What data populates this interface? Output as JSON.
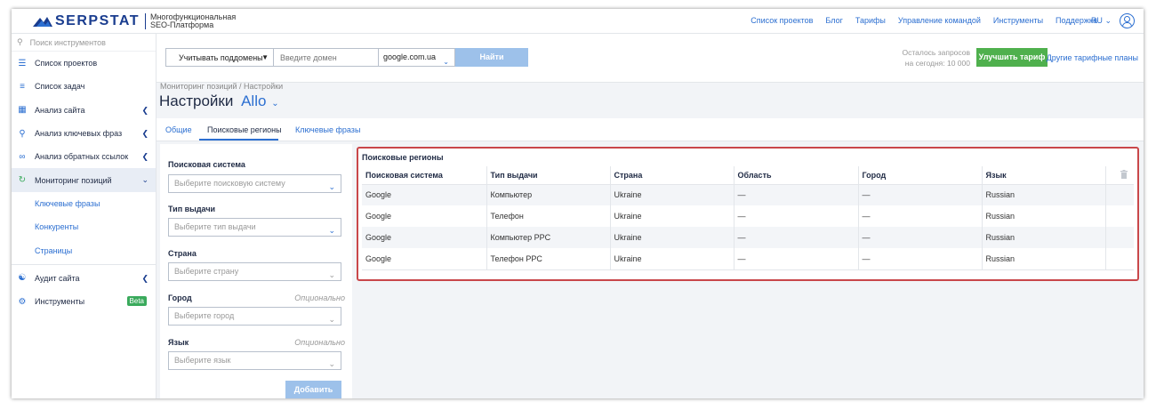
{
  "brand": {
    "name": "SERPSTAT",
    "tagline_line1": "Многофункциональная",
    "tagline_line2": "SEO-Платформа"
  },
  "topnav": {
    "items": [
      "Список проектов",
      "Блог",
      "Тарифы",
      "Управление командой",
      "Инструменты",
      "Поддержка"
    ],
    "language": "RU"
  },
  "sidebar": {
    "search_placeholder": "Поиск инструментов",
    "items": [
      {
        "label": "Список проектов"
      },
      {
        "label": "Список задач"
      },
      {
        "label": "Анализ сайта"
      },
      {
        "label": "Анализ ключевых фраз"
      },
      {
        "label": "Анализ обратных ссылок"
      },
      {
        "label": "Мониторинг позиций"
      }
    ],
    "sub_items": [
      "Ключевые фразы",
      "Конкуренты",
      "Страницы"
    ],
    "bottom_items": [
      {
        "label": "Аудит сайта"
      },
      {
        "label": "Инструменты",
        "badge": "Beta"
      }
    ]
  },
  "toolbar": {
    "subdomain_label": "Учитывать поддомены",
    "domain_placeholder": "Введите домен",
    "engine_value": "google.com.ua",
    "find_label": "Найти",
    "quota_line1": "Осталось запросов",
    "quota_line2": "на сегодня: 10 000",
    "upgrade_label": "Улучшить тариф",
    "other_plans_label": "Другие тарифные планы"
  },
  "header": {
    "breadcrumb": "Мониторинг позиций / Настройки",
    "title": "Настройки",
    "project": "Allo"
  },
  "tabs": [
    "Общие",
    "Поисковые регионы",
    "Ключевые фразы"
  ],
  "form": {
    "engine_label": "Поисковая система",
    "engine_placeholder": "Выберите поисковую систему",
    "type_label": "Тип выдачи",
    "type_placeholder": "Выберите тип выдачи",
    "country_label": "Страна",
    "country_placeholder": "Выберите страну",
    "city_label": "Город",
    "city_placeholder": "Выберите город",
    "language_label": "Язык",
    "language_placeholder": "Выберите язык",
    "optional_text": "Опционально",
    "add_label": "Добавить"
  },
  "results": {
    "title": "Поисковые регионы",
    "columns": [
      "Поисковая система",
      "Тип выдачи",
      "Страна",
      "Область",
      "Город",
      "Язык"
    ],
    "rows": [
      [
        "Google",
        "Компьютер",
        "Ukraine",
        "—",
        "—",
        "Russian"
      ],
      [
        "Google",
        "Телефон",
        "Ukraine",
        "—",
        "—",
        "Russian"
      ],
      [
        "Google",
        "Компьютер PPC",
        "Ukraine",
        "—",
        "—",
        "Russian"
      ],
      [
        "Google",
        "Телефон PPC",
        "Ukraine",
        "—",
        "—",
        "Russian"
      ]
    ]
  },
  "colors": {
    "brand_blue": "#1a3d8f",
    "link_blue": "#2c6fd1",
    "success_green": "#4fb04d",
    "highlight_red": "#c9474a"
  }
}
